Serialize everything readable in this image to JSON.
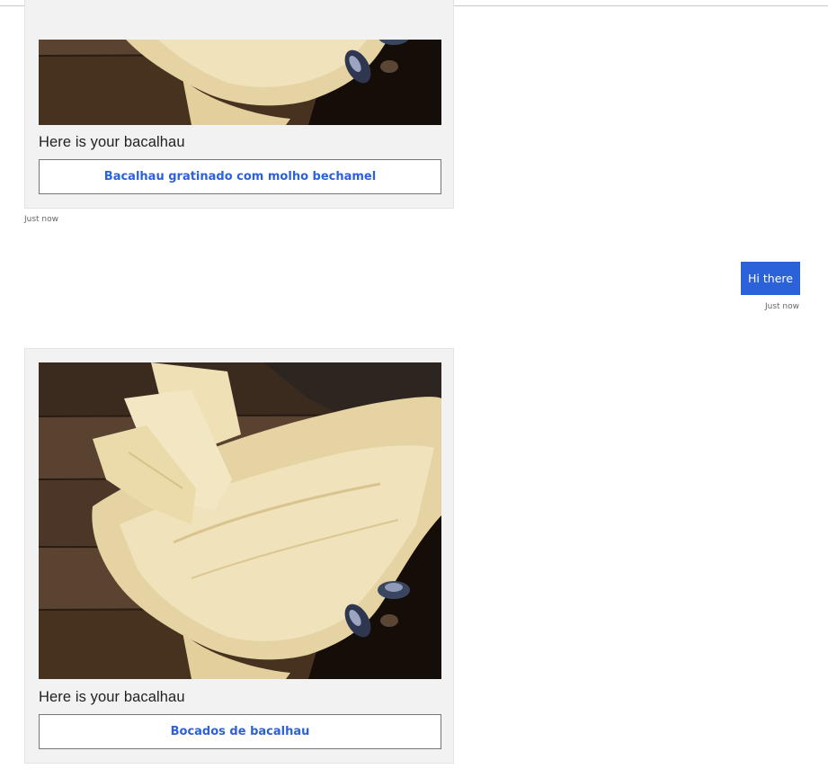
{
  "header": {
    "clipped_link_text": ""
  },
  "messages": [
    {
      "from": "bot",
      "image": "dried-salted-cod-photo",
      "text": "Here is your bacalhau",
      "button_label": "Bacalhau gratinado com molho bechamel",
      "timestamp": "Just now"
    },
    {
      "from": "user",
      "text": "Hi there",
      "timestamp": "Just now"
    },
    {
      "from": "bot",
      "image": "dried-salted-cod-photo",
      "text": "Here is your bacalhau",
      "button_label": "Bocados de bacalhau",
      "timestamp": ""
    }
  ],
  "colors": {
    "accent": "#2b62d9",
    "card_bg": "#f2f2f2",
    "button_border": "#767676"
  }
}
